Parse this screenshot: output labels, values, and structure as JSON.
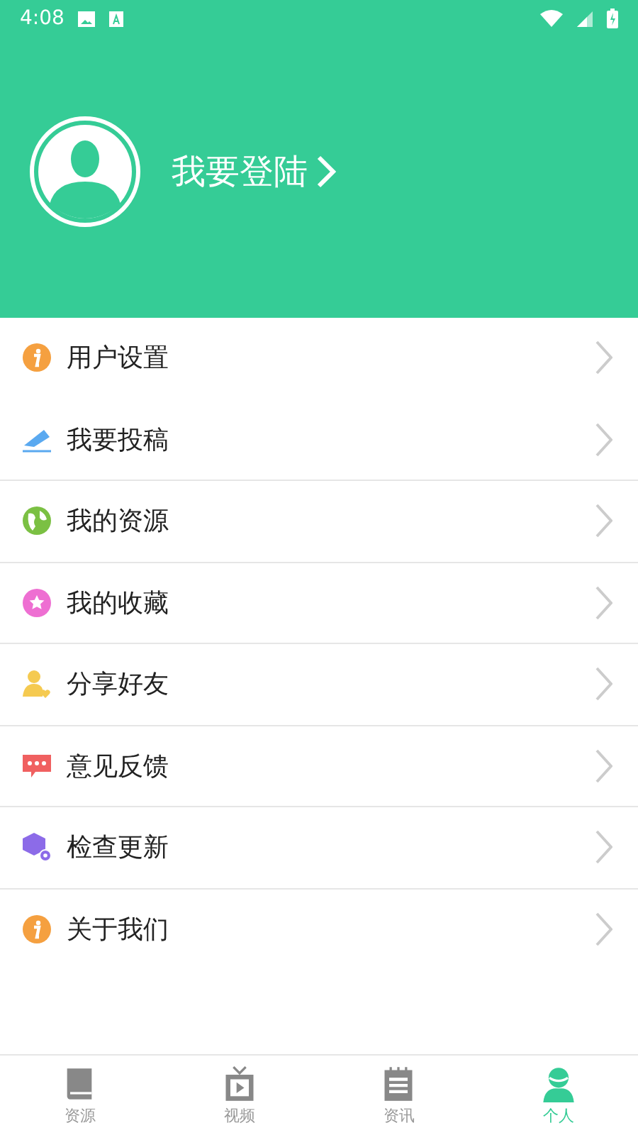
{
  "status_bar": {
    "time": "4:08"
  },
  "profile": {
    "login_label": "我要登陆"
  },
  "menu": [
    {
      "label": "用户设置",
      "kind": "info"
    },
    {
      "label": "我要投稿",
      "kind": "send"
    },
    {
      "label": "我的资源",
      "kind": "globe"
    },
    {
      "label": "我的收藏",
      "kind": "star"
    },
    {
      "label": "分享好友",
      "kind": "share"
    },
    {
      "label": "意见反馈",
      "kind": "chat"
    },
    {
      "label": "检查更新",
      "kind": "cube"
    },
    {
      "label": "关于我们",
      "kind": "info"
    }
  ],
  "tab_bar": [
    {
      "label": "资源",
      "kind": "book",
      "selected": false
    },
    {
      "label": "视频",
      "kind": "tv",
      "selected": false
    },
    {
      "label": "资讯",
      "kind": "notepad",
      "selected": false
    },
    {
      "label": "个人",
      "kind": "person",
      "selected": true
    }
  ]
}
